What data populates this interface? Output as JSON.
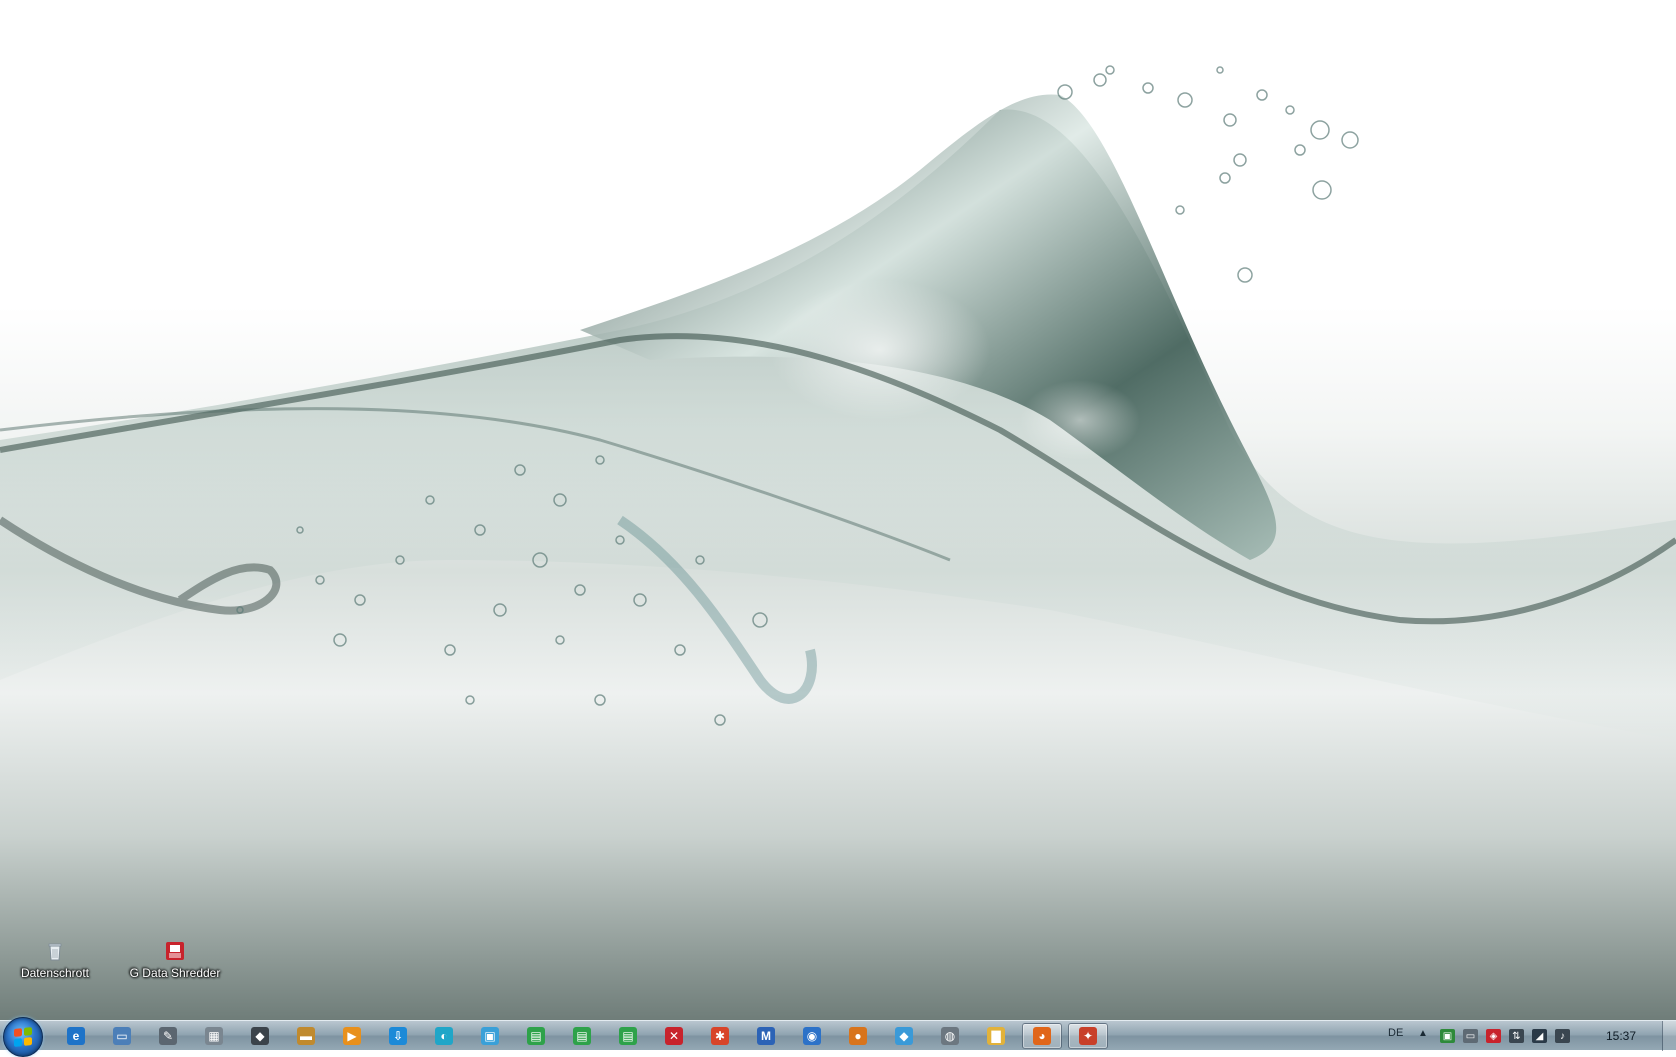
{
  "desktop": {
    "icons": [
      {
        "label": "Datenschrott"
      },
      {
        "label": "G Data Shredder"
      }
    ]
  },
  "taskbar": {
    "pinned": [
      {
        "name": "internet-explorer-icon",
        "glyph": "e",
        "color": "#1e73c8"
      },
      {
        "name": "explorer-window-icon",
        "glyph": "▭",
        "color": "#4c7fb8"
      },
      {
        "name": "document-editor-icon",
        "glyph": "✎",
        "color": "#5b6670"
      },
      {
        "name": "calculator-icon",
        "glyph": "▦",
        "color": "#7a8690"
      },
      {
        "name": "media-tool-icon",
        "glyph": "◆",
        "color": "#3b434a"
      },
      {
        "name": "folder-stack-icon",
        "glyph": "▬",
        "color": "#c08a2e"
      },
      {
        "name": "media-player-icon",
        "glyph": "▶",
        "color": "#e8901c"
      },
      {
        "name": "download-manager-icon",
        "glyph": "⇩",
        "color": "#1c8ad8"
      },
      {
        "name": "browser-globe-icon",
        "glyph": "◐",
        "color": "#20a6c8"
      },
      {
        "name": "photo-viewer-icon",
        "glyph": "▣",
        "color": "#3aa0d8"
      },
      {
        "name": "green-app-1-icon",
        "glyph": "▤",
        "color": "#2ea24a"
      },
      {
        "name": "green-app-2-icon",
        "glyph": "▤",
        "color": "#2ea24a"
      },
      {
        "name": "green-app-3-icon",
        "glyph": "▤",
        "color": "#2ea24a"
      },
      {
        "name": "red-x-app-icon",
        "glyph": "✕",
        "color": "#c8232c"
      },
      {
        "name": "paint-tool-icon",
        "glyph": "✱",
        "color": "#d8452a"
      },
      {
        "name": "mail-client-icon",
        "glyph": "M",
        "color": "#2c63b6"
      },
      {
        "name": "network-globe-icon",
        "glyph": "◉",
        "color": "#2c72c8"
      },
      {
        "name": "disc-burner-icon",
        "glyph": "●",
        "color": "#d8741c"
      },
      {
        "name": "diamond-app-icon",
        "glyph": "◆",
        "color": "#3a9ad8"
      },
      {
        "name": "scanner-app-icon",
        "glyph": "◍",
        "color": "#6c7780"
      },
      {
        "name": "file-explorer-icon",
        "glyph": "▇",
        "color": "#e2b23a"
      },
      {
        "name": "firefox-icon",
        "glyph": "◕",
        "color": "#e0661a",
        "running": true
      },
      {
        "name": "active-app-icon",
        "glyph": "✦",
        "color": "#c8402a",
        "running": true
      }
    ],
    "tray": {
      "language": "DE",
      "overflow_arrow": "▲",
      "icons": [
        {
          "name": "network-monitor-icon",
          "glyph": "▣",
          "color": "#2e8a3a"
        },
        {
          "name": "remote-display-icon",
          "glyph": "▭",
          "color": "#5e6a74"
        },
        {
          "name": "g-data-shield-icon",
          "glyph": "◈",
          "color": "#c8232c"
        },
        {
          "name": "network-connection-icon",
          "glyph": "⇅",
          "color": "#3a4650"
        },
        {
          "name": "performance-graph-icon",
          "glyph": "◢",
          "color": "#2a3a48"
        },
        {
          "name": "volume-icon",
          "glyph": "♪",
          "color": "#3a4650"
        }
      ],
      "clock": "15:37"
    }
  }
}
